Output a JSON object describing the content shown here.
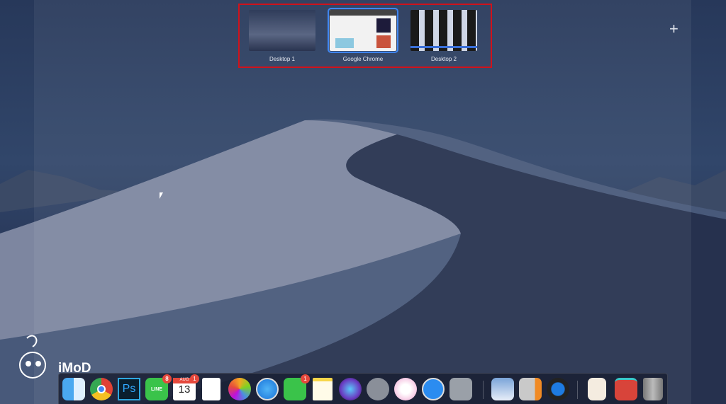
{
  "spaces": [
    {
      "label": "Desktop 1",
      "selected": false
    },
    {
      "label": "Google Chrome",
      "selected": true
    },
    {
      "label": "Desktop 2",
      "selected": false
    }
  ],
  "add_space_icon": "+",
  "logo": {
    "text": "iMoD"
  },
  "dock": {
    "items": [
      {
        "name": "finder",
        "badge": null
      },
      {
        "name": "google-chrome",
        "badge": null
      },
      {
        "name": "photoshop",
        "label": "Ps",
        "badge": null
      },
      {
        "name": "line",
        "label": "LINE",
        "badge": "8"
      },
      {
        "name": "calendar",
        "month": "AUG",
        "day": "13",
        "badge": "1"
      },
      {
        "name": "reminders",
        "badge": null
      },
      {
        "name": "photos",
        "badge": null
      },
      {
        "name": "safari",
        "badge": null
      },
      {
        "name": "facetime",
        "badge": "1"
      },
      {
        "name": "notes",
        "badge": null
      },
      {
        "name": "siri",
        "badge": null
      },
      {
        "name": "launchpad",
        "badge": null
      },
      {
        "name": "itunes",
        "badge": null
      },
      {
        "name": "app-store",
        "badge": null
      },
      {
        "name": "system-preferences",
        "badge": null
      },
      {
        "name": "preview",
        "badge": null
      },
      {
        "name": "numbers",
        "badge": null
      },
      {
        "name": "quicktime",
        "badge": null
      },
      {
        "name": "document",
        "badge": null
      },
      {
        "name": "creative-cloud-folder",
        "badge": null
      },
      {
        "name": "trash",
        "badge": null
      }
    ]
  }
}
